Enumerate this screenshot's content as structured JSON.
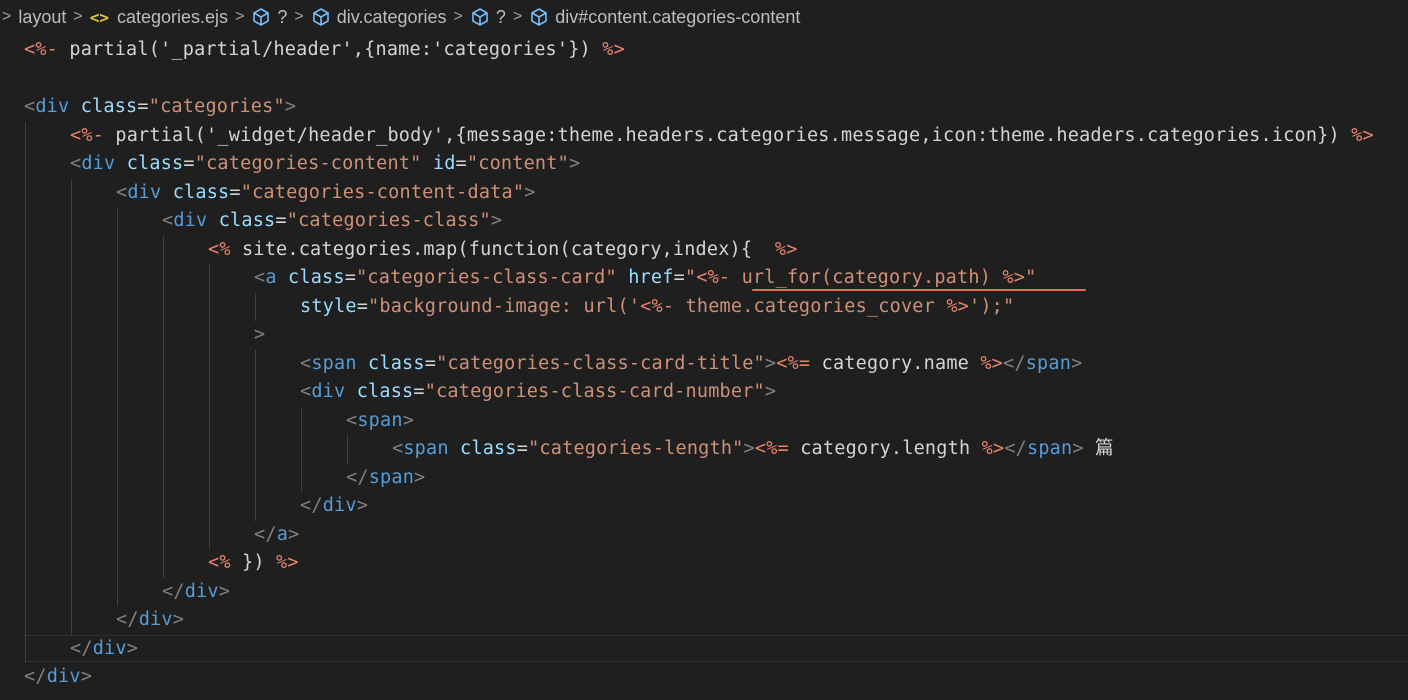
{
  "breadcrumb": {
    "items": [
      "layout",
      "categories.ejs",
      "?",
      "div.categories",
      "?",
      "div#content.categories-content"
    ]
  },
  "code": {
    "lines": [
      [
        [
          "ejs",
          "<%-"
        ],
        [
          "txt",
          " partial('_partial/header',{name:'categories'}) "
        ],
        [
          "ejs",
          "%>"
        ]
      ],
      [],
      [
        [
          "punct",
          "<"
        ],
        [
          "tag",
          "div"
        ],
        [
          "txt",
          " "
        ],
        [
          "attr",
          "class"
        ],
        [
          "txt",
          "="
        ],
        [
          "str",
          "\"categories\""
        ],
        [
          "punct",
          ">"
        ]
      ],
      [
        [
          "ejs",
          "<%-"
        ],
        [
          "txt",
          " partial('_widget/header_body',{message:theme.headers.categories.message,icon:theme.headers.categories.icon}) "
        ],
        [
          "ejs",
          "%>"
        ]
      ],
      [
        [
          "punct",
          "<"
        ],
        [
          "tag",
          "div"
        ],
        [
          "txt",
          " "
        ],
        [
          "attr",
          "class"
        ],
        [
          "txt",
          "="
        ],
        [
          "str",
          "\"categories-content\""
        ],
        [
          "txt",
          " "
        ],
        [
          "attr",
          "id"
        ],
        [
          "txt",
          "="
        ],
        [
          "str",
          "\"content\""
        ],
        [
          "punct",
          ">"
        ]
      ],
      [
        [
          "punct",
          "<"
        ],
        [
          "tag",
          "div"
        ],
        [
          "txt",
          " "
        ],
        [
          "attr",
          "class"
        ],
        [
          "txt",
          "="
        ],
        [
          "str",
          "\"categories-content-data\""
        ],
        [
          "punct",
          ">"
        ]
      ],
      [
        [
          "punct",
          "<"
        ],
        [
          "tag",
          "div"
        ],
        [
          "txt",
          " "
        ],
        [
          "attr",
          "class"
        ],
        [
          "txt",
          "="
        ],
        [
          "str",
          "\"categories-class\""
        ],
        [
          "punct",
          ">"
        ]
      ],
      [
        [
          "ejs",
          "<%"
        ],
        [
          "txt",
          " site.categories.map(function(category,index){  "
        ],
        [
          "ejs",
          "%>"
        ]
      ],
      [
        [
          "punct",
          "<"
        ],
        [
          "tag",
          "a"
        ],
        [
          "txt",
          " "
        ],
        [
          "attr",
          "class"
        ],
        [
          "txt",
          "="
        ],
        [
          "str",
          "\"categories-class-card\""
        ],
        [
          "txt",
          " "
        ],
        [
          "attr",
          "href"
        ],
        [
          "txt",
          "="
        ],
        [
          "str",
          "\""
        ],
        [
          "ejs",
          "<%-"
        ],
        [
          "str",
          " url_for(category.path) "
        ],
        [
          "ejs",
          "%>"
        ],
        [
          "str",
          "\""
        ]
      ],
      [
        [
          "attr",
          "style"
        ],
        [
          "txt",
          "="
        ],
        [
          "str",
          "\"background-image: url('"
        ],
        [
          "ejs",
          "<%-"
        ],
        [
          "str",
          " theme.categories_cover "
        ],
        [
          "ejs",
          "%>"
        ],
        [
          "str",
          "');\""
        ]
      ],
      [
        [
          "punct",
          ">"
        ]
      ],
      [
        [
          "punct",
          "<"
        ],
        [
          "tag",
          "span"
        ],
        [
          "txt",
          " "
        ],
        [
          "attr",
          "class"
        ],
        [
          "txt",
          "="
        ],
        [
          "str",
          "\"categories-class-card-title\""
        ],
        [
          "punct",
          ">"
        ],
        [
          "ejs",
          "<%="
        ],
        [
          "txt",
          " category.name "
        ],
        [
          "ejs",
          "%>"
        ],
        [
          "punct",
          "</"
        ],
        [
          "tag",
          "span"
        ],
        [
          "punct",
          ">"
        ]
      ],
      [
        [
          "punct",
          "<"
        ],
        [
          "tag",
          "div"
        ],
        [
          "txt",
          " "
        ],
        [
          "attr",
          "class"
        ],
        [
          "txt",
          "="
        ],
        [
          "str",
          "\"categories-class-card-number\""
        ],
        [
          "punct",
          ">"
        ]
      ],
      [
        [
          "punct",
          "<"
        ],
        [
          "tag",
          "span"
        ],
        [
          "punct",
          ">"
        ]
      ],
      [
        [
          "punct",
          "<"
        ],
        [
          "tag",
          "span"
        ],
        [
          "txt",
          " "
        ],
        [
          "attr",
          "class"
        ],
        [
          "txt",
          "="
        ],
        [
          "str",
          "\"categories-length\""
        ],
        [
          "punct",
          ">"
        ],
        [
          "ejs",
          "<%="
        ],
        [
          "txt",
          " category.length "
        ],
        [
          "ejs",
          "%>"
        ],
        [
          "punct",
          "</"
        ],
        [
          "tag",
          "span"
        ],
        [
          "punct",
          ">"
        ],
        [
          "txt",
          " 篇"
        ]
      ],
      [
        [
          "punct",
          "</"
        ],
        [
          "tag",
          "span"
        ],
        [
          "punct",
          ">"
        ]
      ],
      [
        [
          "punct",
          "</"
        ],
        [
          "tag",
          "div"
        ],
        [
          "punct",
          ">"
        ]
      ],
      [
        [
          "punct",
          "</"
        ],
        [
          "tag",
          "a"
        ],
        [
          "punct",
          ">"
        ]
      ],
      [
        [
          "ejs",
          "<%"
        ],
        [
          "txt",
          " }) "
        ],
        [
          "ejs",
          "%>"
        ]
      ],
      [
        [
          "punct",
          "</"
        ],
        [
          "tag",
          "div"
        ],
        [
          "punct",
          ">"
        ]
      ],
      [
        [
          "punct",
          "</"
        ],
        [
          "tag",
          "div"
        ],
        [
          "punct",
          ">"
        ]
      ],
      [
        [
          "punct",
          "</"
        ],
        [
          "tag",
          "div"
        ],
        [
          "punct",
          ">"
        ]
      ],
      [
        [
          "punct",
          "</"
        ],
        [
          "tag",
          "div"
        ],
        [
          "punct",
          ">"
        ]
      ]
    ]
  },
  "colors": {
    "background": "#1f1f1f",
    "tag": "#569cd6",
    "attribute": "#9cdcfe",
    "string": "#ce9178",
    "ejs_delimiter": "#e8836b",
    "punctuation": "#808080",
    "text": "#d4d4d4",
    "squiggle": "#e06c5a"
  },
  "icons": [
    "chevron-right-icon",
    "ejs-file-icon",
    "symbol-cube-icon"
  ]
}
